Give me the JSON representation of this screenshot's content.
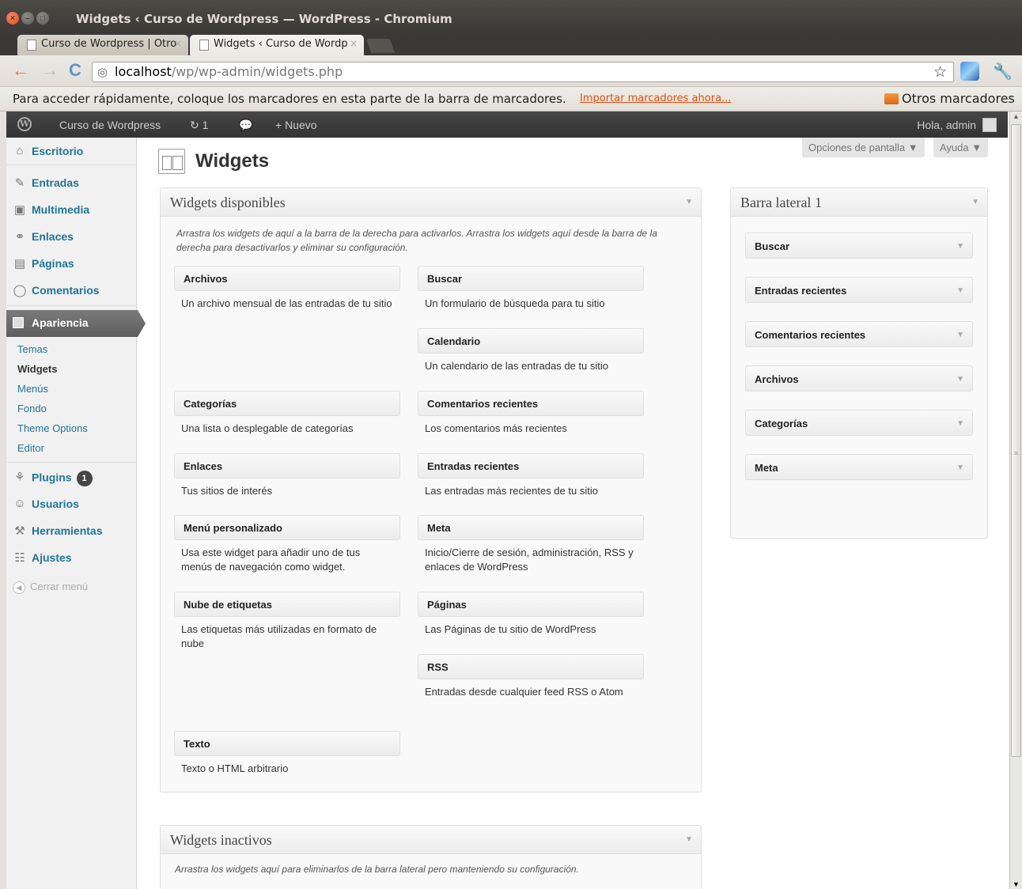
{
  "window": {
    "title": "Widgets ‹ Curso de Wordpress — WordPress - Chromium",
    "close": "×",
    "minimize": "–",
    "maximize": "□"
  },
  "tabs": [
    {
      "label": "Curso de Wordpress | Otro",
      "close": "×"
    },
    {
      "label": "Widgets ‹ Curso de Wordp",
      "close": "×"
    }
  ],
  "toolbar": {
    "back": "←",
    "forward": "→",
    "reload": "C",
    "url_host": "localhost",
    "url_path": "/wp/wp-admin/widgets.php",
    "star": "☆",
    "wrench": "🔧"
  },
  "bookmarks": {
    "prompt": "Para acceder rápidamente, coloque los marcadores en esta parte de la barra de marcadores.",
    "import_link": "Importar marcadores ahora...",
    "other": "Otros marcadores"
  },
  "adminbar": {
    "logo": "W",
    "site_name": "Curso de Wordpress",
    "updates_icon": "↻",
    "updates_count": "1",
    "comments_icon": "💬",
    "new_label": "+ Nuevo",
    "greeting": "Hola, admin"
  },
  "menu": {
    "items": [
      {
        "label": "Escritorio",
        "icon": "⌂"
      },
      {
        "label": "Entradas",
        "icon": "✎"
      },
      {
        "label": "Multimedia",
        "icon": "▣"
      },
      {
        "label": "Enlaces",
        "icon": "⚭"
      },
      {
        "label": "Páginas",
        "icon": "▤"
      },
      {
        "label": "Comentarios",
        "icon": "◯"
      },
      {
        "label": "Apariencia",
        "icon": ""
      },
      {
        "label": "Plugins",
        "icon": "⚘",
        "badge": "1"
      },
      {
        "label": "Usuarios",
        "icon": "☺"
      },
      {
        "label": "Herramientas",
        "icon": "⚒"
      },
      {
        "label": "Ajustes",
        "icon": "☷"
      }
    ],
    "submenu": [
      "Temas",
      "Widgets",
      "Menús",
      "Fondo",
      "Theme Options",
      "Editor"
    ],
    "collapse": "Cerrar menú"
  },
  "screen_options": "Opciones de pantalla ▼",
  "help": "Ayuda ▼",
  "page_title": "Widgets",
  "available": {
    "title": "Widgets disponibles",
    "arrow": "▼",
    "description": "Arrastra los widgets de aquí a la barra de la derecha para activarlos. Arrastra los widgets aquí desde la barra de la derecha para desactivarlos y eliminar su configuración.",
    "widgets": [
      {
        "title": "Archivos",
        "desc": "Un archivo mensual de las entradas de tu sitio"
      },
      {
        "title": "Buscar",
        "desc": "Un formulario de búsqueda para tu sitio"
      },
      {
        "title": "Calendario",
        "desc": "Un calendario de las entradas de tu sitio"
      },
      {
        "title": "Categorías",
        "desc": "Una lista o desplegable de categorías"
      },
      {
        "title": "Comentarios recientes",
        "desc": "Los comentarios más recientes"
      },
      {
        "title": "Enlaces",
        "desc": "Tus sitios de interés"
      },
      {
        "title": "Entradas recientes",
        "desc": "Las entradas más recientes de tu sitio"
      },
      {
        "title": "Menú personalizado",
        "desc": "Usa este widget para añadir uno de tus menús de navegación como widget."
      },
      {
        "title": "Meta",
        "desc": "Inicio/Cierre de sesión, administración, RSS y enlaces de WordPress"
      },
      {
        "title": "Nube de etiquetas",
        "desc": "Las etiquetas más utilizadas en formato de nube"
      },
      {
        "title": "Páginas",
        "desc": "Las Páginas de tu sitio de WordPress"
      },
      {
        "title": "RSS",
        "desc": "Entradas desde cualquier feed RSS o Atom"
      },
      {
        "title": "Texto",
        "desc": "Texto o HTML arbitrario"
      }
    ]
  },
  "sidebar": {
    "title": "Barra lateral 1",
    "arrow": "▼",
    "widgets": [
      "Buscar",
      "Entradas recientes",
      "Comentarios recientes",
      "Archivos",
      "Categorías",
      "Meta"
    ],
    "widget_arrow": "▼"
  },
  "inactive": {
    "title": "Widgets inactivos",
    "arrow": "▼",
    "description": "Arrastra los widgets aquí para eliminarlos de la barra lateral pero manteniendo su configuración."
  },
  "scrollbar": {
    "up": "▲",
    "down": "▼",
    "grip": "≡"
  }
}
